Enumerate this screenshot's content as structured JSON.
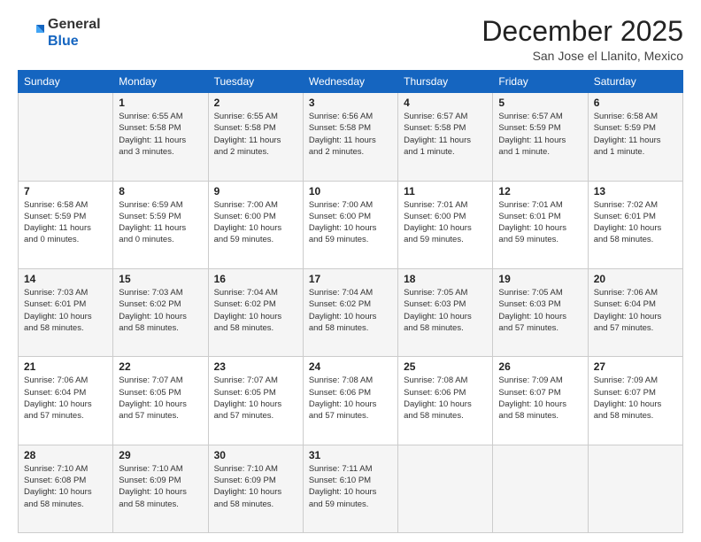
{
  "logo": {
    "general": "General",
    "blue": "Blue"
  },
  "title": "December 2025",
  "location": "San Jose el Llanito, Mexico",
  "days_header": [
    "Sunday",
    "Monday",
    "Tuesday",
    "Wednesday",
    "Thursday",
    "Friday",
    "Saturday"
  ],
  "weeks": [
    [
      {
        "day": "",
        "info": ""
      },
      {
        "day": "1",
        "info": "Sunrise: 6:55 AM\nSunset: 5:58 PM\nDaylight: 11 hours\nand 3 minutes."
      },
      {
        "day": "2",
        "info": "Sunrise: 6:55 AM\nSunset: 5:58 PM\nDaylight: 11 hours\nand 2 minutes."
      },
      {
        "day": "3",
        "info": "Sunrise: 6:56 AM\nSunset: 5:58 PM\nDaylight: 11 hours\nand 2 minutes."
      },
      {
        "day": "4",
        "info": "Sunrise: 6:57 AM\nSunset: 5:58 PM\nDaylight: 11 hours\nand 1 minute."
      },
      {
        "day": "5",
        "info": "Sunrise: 6:57 AM\nSunset: 5:59 PM\nDaylight: 11 hours\nand 1 minute."
      },
      {
        "day": "6",
        "info": "Sunrise: 6:58 AM\nSunset: 5:59 PM\nDaylight: 11 hours\nand 1 minute."
      }
    ],
    [
      {
        "day": "7",
        "info": "Sunrise: 6:58 AM\nSunset: 5:59 PM\nDaylight: 11 hours\nand 0 minutes."
      },
      {
        "day": "8",
        "info": "Sunrise: 6:59 AM\nSunset: 5:59 PM\nDaylight: 11 hours\nand 0 minutes."
      },
      {
        "day": "9",
        "info": "Sunrise: 7:00 AM\nSunset: 6:00 PM\nDaylight: 10 hours\nand 59 minutes."
      },
      {
        "day": "10",
        "info": "Sunrise: 7:00 AM\nSunset: 6:00 PM\nDaylight: 10 hours\nand 59 minutes."
      },
      {
        "day": "11",
        "info": "Sunrise: 7:01 AM\nSunset: 6:00 PM\nDaylight: 10 hours\nand 59 minutes."
      },
      {
        "day": "12",
        "info": "Sunrise: 7:01 AM\nSunset: 6:01 PM\nDaylight: 10 hours\nand 59 minutes."
      },
      {
        "day": "13",
        "info": "Sunrise: 7:02 AM\nSunset: 6:01 PM\nDaylight: 10 hours\nand 58 minutes."
      }
    ],
    [
      {
        "day": "14",
        "info": "Sunrise: 7:03 AM\nSunset: 6:01 PM\nDaylight: 10 hours\nand 58 minutes."
      },
      {
        "day": "15",
        "info": "Sunrise: 7:03 AM\nSunset: 6:02 PM\nDaylight: 10 hours\nand 58 minutes."
      },
      {
        "day": "16",
        "info": "Sunrise: 7:04 AM\nSunset: 6:02 PM\nDaylight: 10 hours\nand 58 minutes."
      },
      {
        "day": "17",
        "info": "Sunrise: 7:04 AM\nSunset: 6:02 PM\nDaylight: 10 hours\nand 58 minutes."
      },
      {
        "day": "18",
        "info": "Sunrise: 7:05 AM\nSunset: 6:03 PM\nDaylight: 10 hours\nand 58 minutes."
      },
      {
        "day": "19",
        "info": "Sunrise: 7:05 AM\nSunset: 6:03 PM\nDaylight: 10 hours\nand 57 minutes."
      },
      {
        "day": "20",
        "info": "Sunrise: 7:06 AM\nSunset: 6:04 PM\nDaylight: 10 hours\nand 57 minutes."
      }
    ],
    [
      {
        "day": "21",
        "info": "Sunrise: 7:06 AM\nSunset: 6:04 PM\nDaylight: 10 hours\nand 57 minutes."
      },
      {
        "day": "22",
        "info": "Sunrise: 7:07 AM\nSunset: 6:05 PM\nDaylight: 10 hours\nand 57 minutes."
      },
      {
        "day": "23",
        "info": "Sunrise: 7:07 AM\nSunset: 6:05 PM\nDaylight: 10 hours\nand 57 minutes."
      },
      {
        "day": "24",
        "info": "Sunrise: 7:08 AM\nSunset: 6:06 PM\nDaylight: 10 hours\nand 57 minutes."
      },
      {
        "day": "25",
        "info": "Sunrise: 7:08 AM\nSunset: 6:06 PM\nDaylight: 10 hours\nand 58 minutes."
      },
      {
        "day": "26",
        "info": "Sunrise: 7:09 AM\nSunset: 6:07 PM\nDaylight: 10 hours\nand 58 minutes."
      },
      {
        "day": "27",
        "info": "Sunrise: 7:09 AM\nSunset: 6:07 PM\nDaylight: 10 hours\nand 58 minutes."
      }
    ],
    [
      {
        "day": "28",
        "info": "Sunrise: 7:10 AM\nSunset: 6:08 PM\nDaylight: 10 hours\nand 58 minutes."
      },
      {
        "day": "29",
        "info": "Sunrise: 7:10 AM\nSunset: 6:09 PM\nDaylight: 10 hours\nand 58 minutes."
      },
      {
        "day": "30",
        "info": "Sunrise: 7:10 AM\nSunset: 6:09 PM\nDaylight: 10 hours\nand 58 minutes."
      },
      {
        "day": "31",
        "info": "Sunrise: 7:11 AM\nSunset: 6:10 PM\nDaylight: 10 hours\nand 59 minutes."
      },
      {
        "day": "",
        "info": ""
      },
      {
        "day": "",
        "info": ""
      },
      {
        "day": "",
        "info": ""
      }
    ]
  ]
}
